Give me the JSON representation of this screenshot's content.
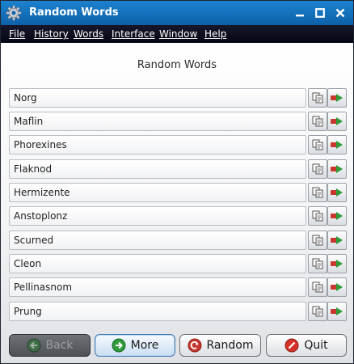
{
  "window": {
    "title": "Random Words",
    "colors": {
      "titlebar": "#1577c4",
      "menubar": "#0b0c1c",
      "accent_border": "#4a7fb4"
    }
  },
  "menu": [
    {
      "label": "File"
    },
    {
      "label": "History"
    },
    {
      "label": "Words"
    },
    {
      "label": "Interface"
    },
    {
      "label": "Window"
    },
    {
      "label": "Help"
    }
  ],
  "main": {
    "heading": "Random Words",
    "words": [
      "Norg",
      "Maflin",
      "Phorexines",
      "Flaknod",
      "Hermizente",
      "Anstoplonz",
      "Scurned",
      "Cleon",
      "Pellinasnom",
      "Prung"
    ],
    "row_icons": {
      "copy": "copy-icon",
      "send": "send-icon"
    }
  },
  "buttons": {
    "back": {
      "label": "Back",
      "icon": "arrow-left-icon",
      "enabled": false
    },
    "more": {
      "label": "More",
      "icon": "arrow-right-icon",
      "enabled": true
    },
    "random": {
      "label": "Random",
      "icon": "refresh-icon",
      "enabled": true
    },
    "quit": {
      "label": "Quit",
      "icon": "no-entry-icon",
      "enabled": true
    }
  }
}
